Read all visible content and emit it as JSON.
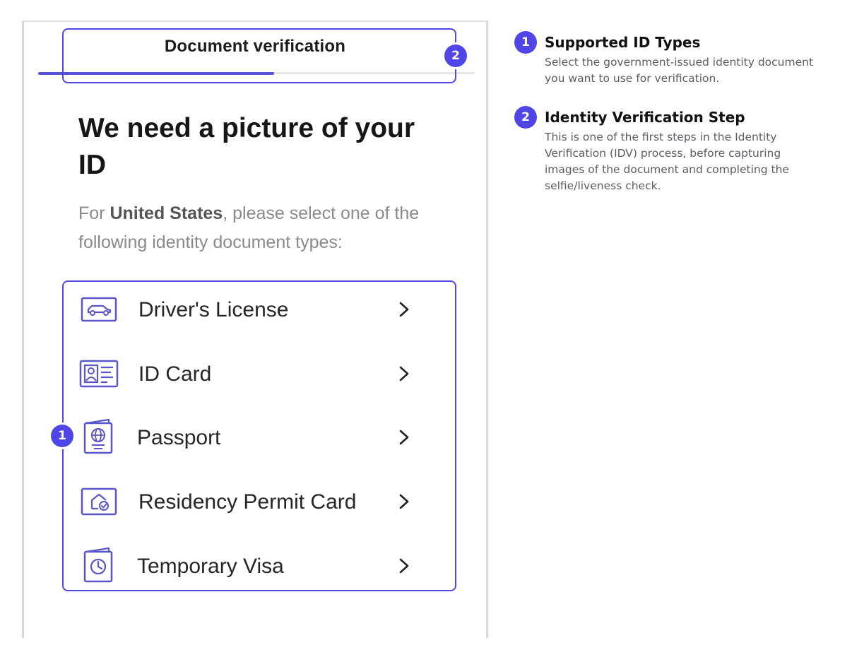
{
  "header": {
    "title": "Document verification",
    "progress_percent": 54
  },
  "main": {
    "heading": "We need a picture of your ID",
    "subtitle_prefix": "For ",
    "subtitle_country": "United States",
    "subtitle_suffix": ", please select one of the following identity document types:"
  },
  "document_types": [
    {
      "label": "Driver's License",
      "icon": "car-icon"
    },
    {
      "label": "ID Card",
      "icon": "id-card-icon"
    },
    {
      "label": "Passport",
      "icon": "passport-icon"
    },
    {
      "label": "Residency Permit Card",
      "icon": "house-check-icon"
    },
    {
      "label": "Temporary Visa",
      "icon": "clock-document-icon"
    }
  ],
  "annotations": [
    {
      "number": "1",
      "title": "Supported ID Types",
      "body": "Select the government-issued identity document you want to use for verification."
    },
    {
      "number": "2",
      "title": "Identity Verification Step",
      "body": "This is one of the first steps in the Identity Verification (IDV) process, before capturing images of the document and completing the selfie/liveness check."
    }
  ],
  "colors": {
    "accent": "#4f46e5",
    "progress": "#5552d6",
    "icon_stroke": "#5a56c9"
  }
}
